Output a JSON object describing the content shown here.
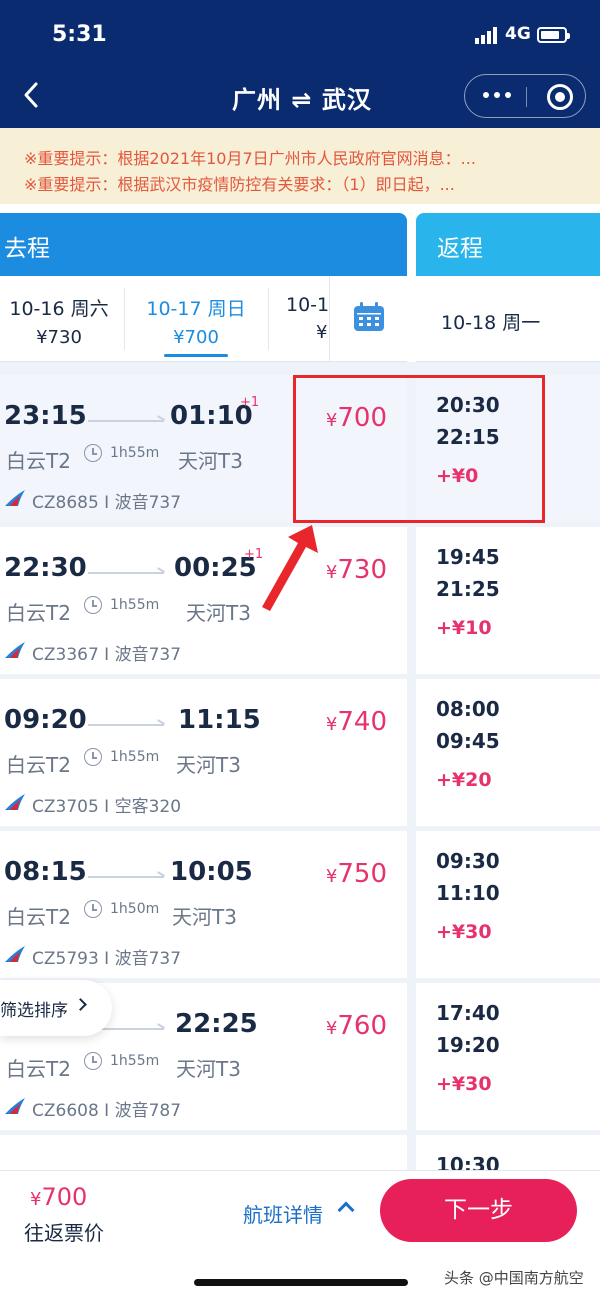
{
  "status": {
    "time": "5:31",
    "network": "4G"
  },
  "nav": {
    "title": "广州 ⇌ 武汉"
  },
  "notices": [
    "※重要提示：根据2021年10月7日广州市人民政府官网消息：...",
    "※重要提示：根据武汉市疫情防控有关要求：（1）即日起，..."
  ],
  "direction": {
    "outbound": "去程",
    "return": "返程"
  },
  "dates": [
    {
      "date": "10-16 周六",
      "price": "¥730"
    },
    {
      "date": "10-17 周日",
      "price": "¥700"
    },
    {
      "date": "10-1",
      "price": "¥"
    }
  ],
  "return_date": "10-18 周一",
  "flights": [
    {
      "dep": "23:15",
      "arr": "01:10",
      "plus": "+1",
      "dep_ap": "白云T2",
      "duration": "1h55m",
      "arr_ap": "天河T3",
      "flight": "CZ8685 I 波音737",
      "price": "700",
      "ret_dep": "20:30",
      "ret_arr": "22:15",
      "ret_diff": "+¥0"
    },
    {
      "dep": "22:30",
      "arr": "00:25",
      "plus": "+1",
      "dep_ap": "白云T2",
      "duration": "1h55m",
      "arr_ap": "天河T3",
      "flight": "CZ3367 I 波音737",
      "price": "730",
      "ret_dep": "19:45",
      "ret_arr": "21:25",
      "ret_diff": "+¥10"
    },
    {
      "dep": "09:20",
      "arr": "11:15",
      "plus": "",
      "dep_ap": "白云T2",
      "duration": "1h55m",
      "arr_ap": "天河T3",
      "flight": "CZ3705 I 空客320",
      "price": "740",
      "ret_dep": "08:00",
      "ret_arr": "09:45",
      "ret_diff": "+¥20"
    },
    {
      "dep": "08:15",
      "arr": "10:05",
      "plus": "",
      "dep_ap": "白云T2",
      "duration": "1h50m",
      "arr_ap": "天河T3",
      "flight": "CZ5793 I 波音737",
      "price": "750",
      "ret_dep": "09:30",
      "ret_arr": "11:10",
      "ret_diff": "+¥30"
    },
    {
      "dep": "",
      "arr": "22:25",
      "plus": "",
      "dep_ap": "白云T2",
      "duration": "1h55m",
      "arr_ap": "天河T3",
      "flight": "CZ6608 I 波音787",
      "price": "760",
      "ret_dep": "17:40",
      "ret_arr": "19:20",
      "ret_diff": "+¥30"
    }
  ],
  "partial_return_time": "10:30",
  "currency": "¥",
  "filter_label": "筛选排序",
  "bottom": {
    "total_price": "700",
    "total_label": "往返票价",
    "details_label": "航班详情",
    "next_label": "下一步",
    "watermark": "头条 @中国南方航空"
  },
  "colors": {
    "header": "#0b2b70",
    "accent_blue": "#1b8ce0",
    "price_red": "#e6336b",
    "highlight": "#e8262b"
  }
}
